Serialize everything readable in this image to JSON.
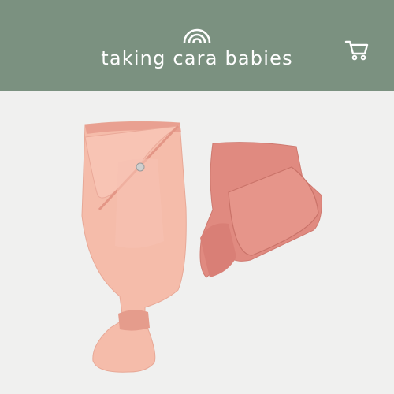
{
  "header": {
    "brand_name": "taking cara babies",
    "background_color": "#7b9180",
    "logo_icon": "rainbow-icon",
    "cart_icon": "shopping-cart-icon"
  },
  "main": {
    "image_subject": "product-photo",
    "background_color": "#f0f0ef",
    "product_colors": [
      "#f4b8a6",
      "#e08a80"
    ]
  }
}
